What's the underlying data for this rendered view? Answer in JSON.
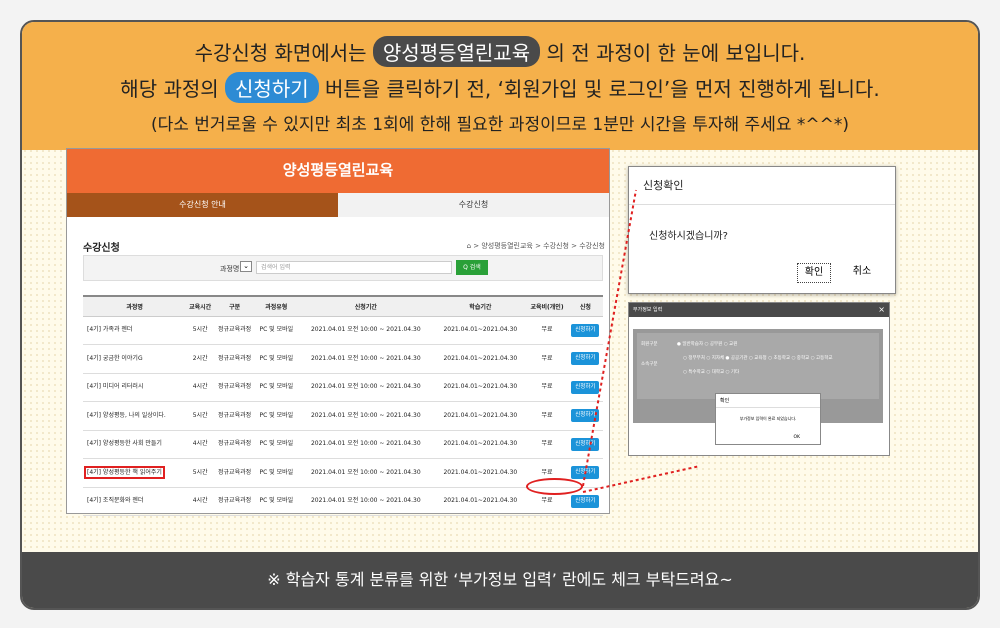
{
  "header": {
    "l1_pre": "수강신청 화면에서는",
    "l1_pill": "양성평등열린교육",
    "l1_post": "의 전 과정이 한 눈에 보입니다.",
    "l2_pre": "해당 과정의",
    "l2_pill": "신청하기",
    "l2_post": "버튼을 클릭하기 전, ‘회원가입 및 로그인’을 먼저 진행하게 됩니다.",
    "l3": "(다소 번거로울 수 있지만 최초 1회에 한해 필요한 과정이므로 1분만 시간을 투자해 주세요 *^^*)"
  },
  "footer": "※ 학습자 통계 분류를 위한 ‘부가정보 입력’ 란에도 체크 부탁드려요~",
  "shot": {
    "title": "양성평등열린교육",
    "tab1": "수강신청 안내",
    "tab2": "수강신청",
    "section": "수강신청",
    "breadcrumb": "⌂ > 양성평등열린교육 > 수강신청 > 수강신청",
    "search_label": "과정명",
    "search_placeholder": "검색어 입력",
    "search_button": "Q 검색",
    "columns": [
      "과정명",
      "교육시간",
      "구분",
      "과정유형",
      "신청기간",
      "학습기간",
      "교육비(개인)",
      "신청"
    ],
    "rows": [
      {
        "name": "[4기] 가족과 젠더",
        "hours": "5시간",
        "kind": "정규교육과정",
        "type": "PC 및 모바일",
        "apply": "2021.04.01 오전 10:00 ~ 2021.04.30",
        "study": "2021.04.01~2021.04.30",
        "fee": "무료",
        "btn": "신청하기"
      },
      {
        "name": "[4기] 궁금한 이야기G",
        "hours": "2시간",
        "kind": "정규교육과정",
        "type": "PC 및 모바일",
        "apply": "2021.04.01 오전 10:00 ~ 2021.04.30",
        "study": "2021.04.01~2021.04.30",
        "fee": "무료",
        "btn": "신청하기"
      },
      {
        "name": "[4기] 미디어 리터러시",
        "hours": "4시간",
        "kind": "정규교육과정",
        "type": "PC 및 모바일",
        "apply": "2021.04.01 오전 10:00 ~ 2021.04.30",
        "study": "2021.04.01~2021.04.30",
        "fee": "무료",
        "btn": "신청하기"
      },
      {
        "name": "[4기] 양성평등, 나의 일상이다.",
        "hours": "5시간",
        "kind": "정규교육과정",
        "type": "PC 및 모바일",
        "apply": "2021.04.01 오전 10:00 ~ 2021.04.30",
        "study": "2021.04.01~2021.04.30",
        "fee": "무료",
        "btn": "신청하기"
      },
      {
        "name": "[4기] 양성평등한 사회 만들기",
        "hours": "4시간",
        "kind": "정규교육과정",
        "type": "PC 및 모바일",
        "apply": "2021.04.01 오전 10:00 ~ 2021.04.30",
        "study": "2021.04.01~2021.04.30",
        "fee": "무료",
        "btn": "신청하기"
      },
      {
        "name": "[4기] 양성평등한 책 읽어주기",
        "hours": "5시간",
        "kind": "정규교육과정",
        "type": "PC 및 모바일",
        "apply": "2021.04.01 오전 10:00 ~ 2021.04.30",
        "study": "2021.04.01~2021.04.30",
        "fee": "무료",
        "btn": "신청하기"
      },
      {
        "name": "[4기] 조직문화와 젠더",
        "hours": "4시간",
        "kind": "정규교육과정",
        "type": "PC 및 모바일",
        "apply": "2021.04.01 오전 10:00 ~ 2021.04.30",
        "study": "2021.04.01~2021.04.30",
        "fee": "무료",
        "btn": "신청하기"
      }
    ]
  },
  "dialog": {
    "title": "신청확인",
    "message": "신청하시겠습니까?",
    "ok": "확인",
    "cancel": "취소"
  },
  "popup": {
    "title": "부가정보 입력",
    "close": "×",
    "row1_label": "회원구분",
    "row1_opts": "● 일반학습자  ○ 공무원  ○ 교원",
    "row2_label": "소속구분",
    "row2_opts_a": "○ 정부부처  ○ 지자체  ● 공공기관  ○ 교육청  ○ 초등학교  ○ 중학교  ○ 고등학교",
    "row2_opts_b": "○ 특수학교  ○ 대학교  ○ 기타",
    "mini_title": "확인",
    "mini_msg": "부가정보 입력이 완료 되었습니다.",
    "mini_ok": "OK"
  }
}
